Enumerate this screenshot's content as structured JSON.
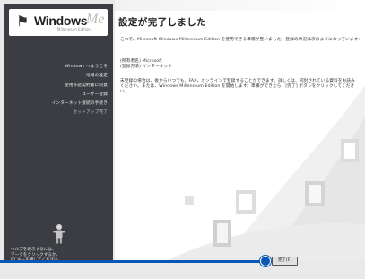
{
  "logo": {
    "brand": "Windows",
    "version_mark": "Me",
    "edition": "Millennium Edition"
  },
  "sidebar": {
    "steps": [
      {
        "label": "Windows へようこそ"
      },
      {
        "label": "地域の設定"
      },
      {
        "label": "使用許諾契約書に同意"
      },
      {
        "label": "ユーザー登録"
      },
      {
        "label": "インターネット接続の手続き"
      },
      {
        "label": "セットアップ完了",
        "current": true
      }
    ],
    "help_text": [
      "ヘルプを表示するには、",
      "マークをクリックするか、",
      "F1 キーを押してください。"
    ]
  },
  "main": {
    "title": "設定が完了しました",
    "intro": "これで、Microsoft Windows Millennium Edition を使用できる準備が整いました。登録の状況は次のようになっています:",
    "owner_name_line": "(所有者名)  Microsoft",
    "registration_line": "(登録方法)  インターネット",
    "note": "未登録の場合は、後からいつでも、FAX、オンラインで登録することができます。詳しくは、同封されている資料をお読みください。または、Windows Millennium Edition を開始します。準備ができたら、[完了] ボタンをクリックしてください。"
  },
  "footer": {
    "finish_label": "完了(F)"
  },
  "colors": {
    "sidebar": "#3b3d42",
    "callout": "#0a57b5",
    "background": "#e9e9e9"
  }
}
